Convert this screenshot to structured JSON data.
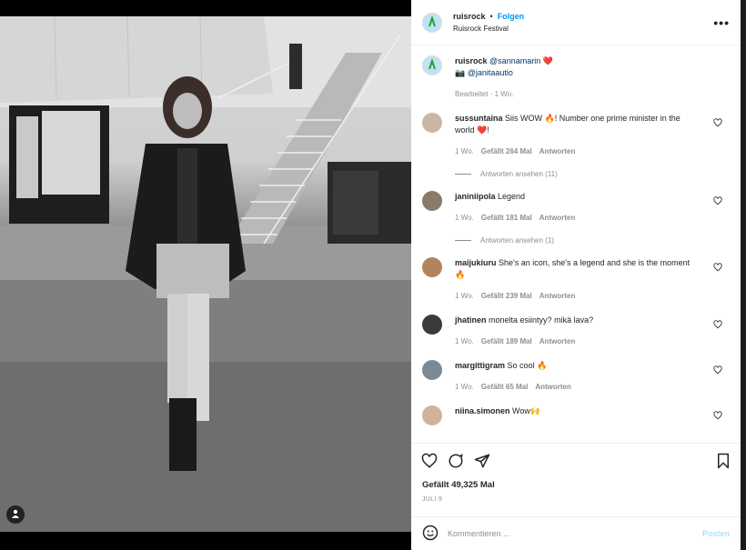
{
  "post": {
    "username": "ruisrock",
    "follow_label": "Folgen",
    "separator": "•",
    "location": "Ruisrock Festival",
    "more_label": "•••"
  },
  "caption": {
    "username": "ruisrock",
    "mention1": "@sannamarin",
    "heart": "❤️",
    "camera": "📷",
    "mention2": "@janitaautio",
    "meta": "Bearbeitet · 1 Wo."
  },
  "comments": [
    {
      "username": "sussuntaina",
      "text": "Siis WOW 🔥! Number one prime minister in the world ❤️!",
      "time": "1 Wo.",
      "likes": "Gefällt 264 Mal",
      "reply": "Antworten",
      "view_replies": "Antworten ansehen (11)"
    },
    {
      "username": "janiniipola",
      "text": "Legend",
      "time": "1 Wo.",
      "likes": "Gefällt 181 Mal",
      "reply": "Antworten",
      "view_replies": "Antworten ansehen (1)"
    },
    {
      "username": "maijukiuru",
      "text": "She's an icon, she's a legend and she is the moment 🔥",
      "time": "1 Wo.",
      "likes": "Gefällt 239 Mal",
      "reply": "Antworten"
    },
    {
      "username": "jhatinen",
      "text": "monelta esiintyy? mikä lava?",
      "time": "1 Wo.",
      "likes": "Gefällt 189 Mal",
      "reply": "Antworten"
    },
    {
      "username": "margittigram",
      "text": "So cool 🔥",
      "time": "1 Wo.",
      "likes": "Gefällt 65 Mal",
      "reply": "Antworten"
    },
    {
      "username": "niina.simonen",
      "text": "Wow🙌"
    }
  ],
  "likes_count": "Gefällt 49,325 Mal",
  "date": "JULI 9",
  "comment_input": {
    "placeholder": "Kommentieren ...",
    "post_label": "Posten"
  },
  "colors": {
    "accent": "#0095f6",
    "text": "#262626",
    "muted": "#8e8e8e",
    "heart": "#ed4956"
  },
  "icons": [
    "heart-icon",
    "comment-icon",
    "share-icon",
    "bookmark-icon",
    "emoji-icon",
    "user-tag-icon",
    "more-icon"
  ]
}
